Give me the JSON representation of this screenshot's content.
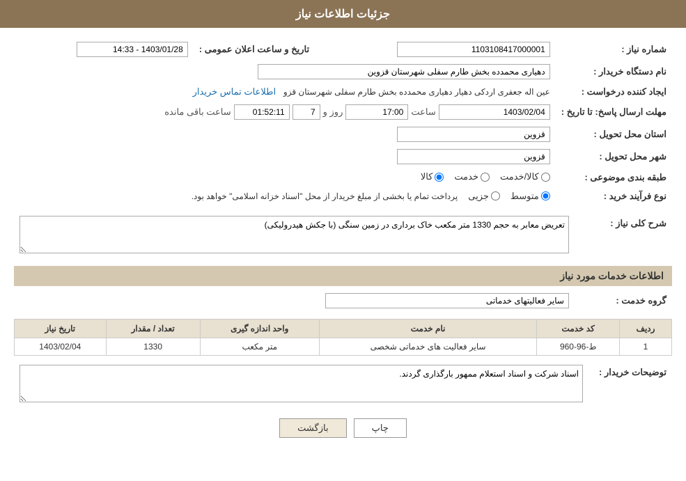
{
  "header": {
    "title": "جزئیات اطلاعات نیاز"
  },
  "fields": {
    "need_number_label": "شماره نیاز :",
    "need_number_value": "1103108417000001",
    "org_name_label": "نام دستگاه خریدار :",
    "org_name_value": "دهیاری محمدده بخش طارم سفلی شهرستان قزوین",
    "created_by_label": "ایجاد کننده درخواست :",
    "created_by_value": "عین اله جعفری اردکی دهیار دهیاری محمدده بخش طارم سفلی شهرستان قزو",
    "created_by_link": "اطلاعات تماس خریدار",
    "reply_deadline_label": "مهلت ارسال پاسخ: تا تاریخ :",
    "announce_datetime_label": "تاریخ و ساعت اعلان عمومی :",
    "announce_datetime_value": "1403/01/28 - 14:33",
    "deadline_date": "1403/02/04",
    "deadline_time": "17:00",
    "deadline_days": "7",
    "deadline_remaining": "01:52:11",
    "deadline_days_label": "روز و",
    "deadline_remaining_label": "ساعت باقی مانده",
    "province_label": "استان محل تحویل :",
    "province_value": "قزوین",
    "city_label": "شهر محل تحویل :",
    "city_value": "قزوین",
    "category_label": "طبقه بندی موضوعی :",
    "category_options": [
      "کالا",
      "خدمت",
      "کالا/خدمت"
    ],
    "category_selected": "کالا",
    "purchase_type_label": "نوع فرآیند خرید :",
    "purchase_type_options": [
      "جزیی",
      "متوسط"
    ],
    "purchase_type_selected": "متوسط",
    "purchase_type_note": "پرداخت تمام یا بخشی از مبلغ خریدار از محل \"اسناد خزانه اسلامی\" خواهد بود.",
    "need_description_label": "شرح کلی نیاز :",
    "need_description_value": "تعریض معابر به حجم 1330 متر مکعب خاک برداری در زمین سنگی (با جکش هیدرولیکی)",
    "services_section_label": "اطلاعات خدمات مورد نیاز",
    "service_group_label": "گروه خدمت :",
    "service_group_value": "سایر فعالیتهای خدماتی",
    "table": {
      "headers": [
        "ردیف",
        "کد خدمت",
        "نام خدمت",
        "واحد اندازه گیری",
        "تعداد / مقدار",
        "تاریخ نیاز"
      ],
      "rows": [
        {
          "row": "1",
          "code": "ط-96-960",
          "name": "سایر فعالیت های خدماتی شخصی",
          "unit": "متر مکعب",
          "quantity": "1330",
          "date": "1403/02/04"
        }
      ]
    },
    "buyer_notes_label": "توضیحات خریدار :",
    "buyer_notes_value": "اسناد شرکت و اسناد استعلام ممهور بارگذاری گردند."
  },
  "buttons": {
    "print_label": "چاپ",
    "back_label": "بازگشت"
  }
}
